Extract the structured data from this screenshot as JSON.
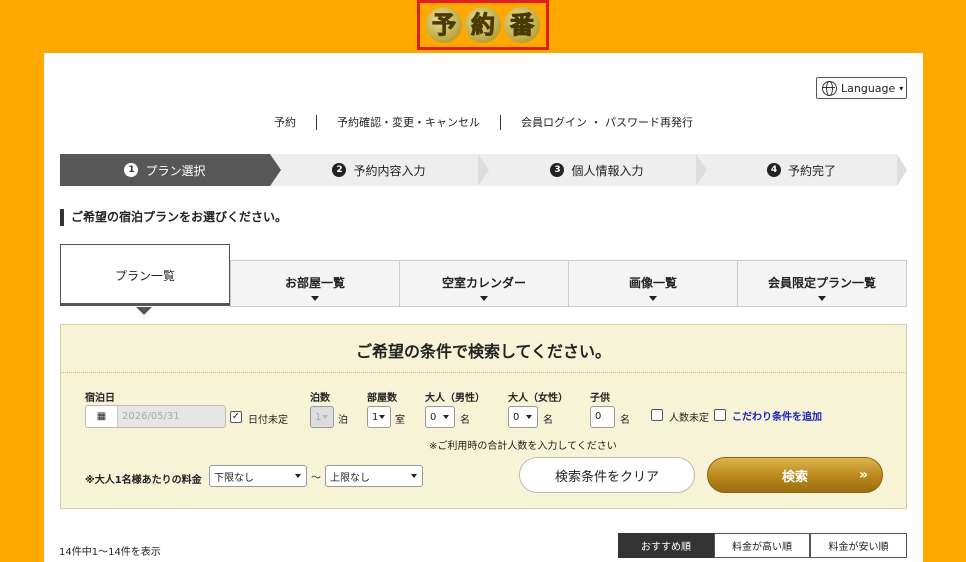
{
  "logo": {
    "chars": [
      "予",
      "約",
      "番"
    ]
  },
  "language": {
    "label": "Language",
    "caret": "▾"
  },
  "topnav": {
    "items": [
      "予約",
      "予約確認・変更・キャンセル",
      "会員ログイン ・ パスワード再発行"
    ]
  },
  "steps": [
    {
      "num": "1",
      "label": "プラン選択",
      "active": true
    },
    {
      "num": "2",
      "label": "予約内容入力",
      "active": false
    },
    {
      "num": "3",
      "label": "個人情報入力",
      "active": false
    },
    {
      "num": "4",
      "label": "予約完了",
      "active": false
    }
  ],
  "heading": "ご希望の宿泊プランをお選びください。",
  "tabs": [
    {
      "label": "プラン一覧",
      "active": true
    },
    {
      "label": "お部屋一覧"
    },
    {
      "label": "空室カレンダー"
    },
    {
      "label": "画像一覧"
    },
    {
      "label": "会員限定プラン一覧"
    }
  ],
  "search": {
    "title": "ご希望の条件で検索してください。",
    "checkin_label": "宿泊日",
    "calendar_icon": "calendar-icon",
    "date_value": "2026/05/31",
    "date_undecided": "日付未定",
    "date_undecided_checked": true,
    "nights_label": "泊数",
    "nights_value": "1",
    "nights_unit": "泊",
    "rooms_label": "部屋数",
    "rooms_value": "1",
    "rooms_unit": "室",
    "adult_male_label": "大人（男性）",
    "adult_male_value": "0",
    "adult_female_label": "大人（女性）",
    "adult_female_value": "0",
    "people_unit": "名",
    "child_label": "子供",
    "child_value": "0",
    "people_undecided": "人数未定",
    "add_conditions": "こだわり条件を追加",
    "note": "※ご利用時の合計人数を入力してください",
    "price_label": "※大人1名様あたりの料金",
    "price_min": "下限なし",
    "price_sep": "～",
    "price_max": "上限なし",
    "clear_button": "検索条件をクリア",
    "search_button": "検索",
    "search_arrow": "»"
  },
  "results": {
    "count_text": "14件中1～14件を表示",
    "sort_options": [
      "おすすめ順",
      "料金が高い順",
      "料金が安い順"
    ],
    "active_sort": "おすすめ順"
  },
  "colors": {
    "background": "#FFA800",
    "accent_gold": "#B8871A",
    "search_panel": "#F7F3D6",
    "link": "#1A23B8"
  }
}
